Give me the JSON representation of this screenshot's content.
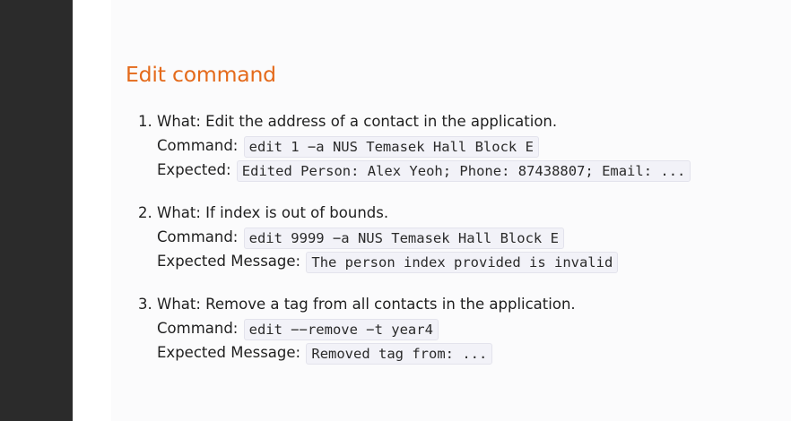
{
  "section": {
    "title": "Edit command"
  },
  "steps": [
    {
      "number": "1.",
      "what": "What: Edit the address of a contact in the application.",
      "command_label": "Command:",
      "command": "edit 1 −a NUS Temasek Hall Block E",
      "expected_label": "Expected:",
      "expected": "Edited Person: Alex Yeoh; Phone: 87438807; Email: ..."
    },
    {
      "number": "2.",
      "what": "What: If index is out of bounds.",
      "command_label": "Command:",
      "command": "edit 9999 −a NUS Temasek Hall Block E",
      "expected_label": "Expected Message:",
      "expected": "The person index provided is invalid"
    },
    {
      "number": "3.",
      "what": "What: Remove a tag from all contacts in the application.",
      "command_label": "Command:",
      "command": "edit −−remove −t year4",
      "expected_label": "Expected Message:",
      "expected": "Removed tag from: ..."
    }
  ]
}
